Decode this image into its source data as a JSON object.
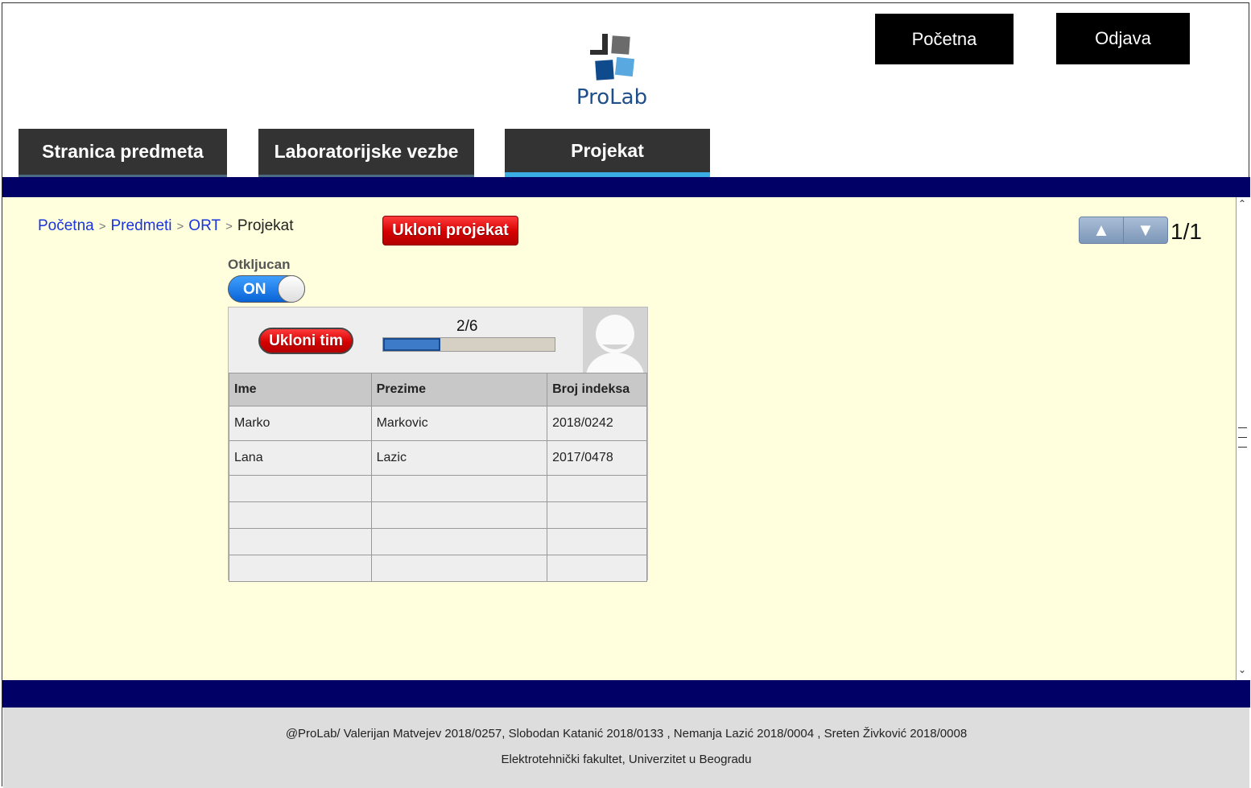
{
  "header": {
    "logo_text": "ProLab",
    "home_button": "Početna",
    "logout_button": "Odjava"
  },
  "tabs": [
    {
      "label": "Stranica predmeta",
      "active": false
    },
    {
      "label": "Laboratorijske vezbe",
      "active": false
    },
    {
      "label": "Projekat",
      "active": true
    }
  ],
  "breadcrumb": {
    "items": [
      "Početna",
      "Predmeti",
      "ORT"
    ],
    "current": "Projekat",
    "separator": ">"
  },
  "remove_project_button": "Ukloni projekat",
  "pager": {
    "up_icon": "▲",
    "down_icon": "▼",
    "page": "1/1"
  },
  "lock": {
    "label": "Otkljucan",
    "toggle_text": "ON"
  },
  "team": {
    "remove_button": "Ukloni tim",
    "progress_text": "2/6",
    "progress_fraction": 0.3333,
    "columns": [
      "Ime",
      "Prezime",
      "Broj indeksa"
    ],
    "rows": [
      [
        "Marko",
        "Markovic",
        "2018/0242"
      ],
      [
        "Lana",
        "Lazic",
        "2017/0478"
      ]
    ]
  },
  "footer": {
    "line1": "@ProLab/ Valerijan Matvejev 2018/0257, Slobodan Katanić 2018/0133 , Nemanja Lazić 2018/0004 , Sreten Živković 2018/0008",
    "line2": "Elektrotehnički fakultet, Univerzitet u Beogradu"
  },
  "colors": {
    "navy": "#000066",
    "content_bg": "#ffffdd",
    "tab_bg": "#333333",
    "tab_active_accent": "#3aaee2",
    "link": "#1a34e0",
    "danger": "#d40000"
  }
}
